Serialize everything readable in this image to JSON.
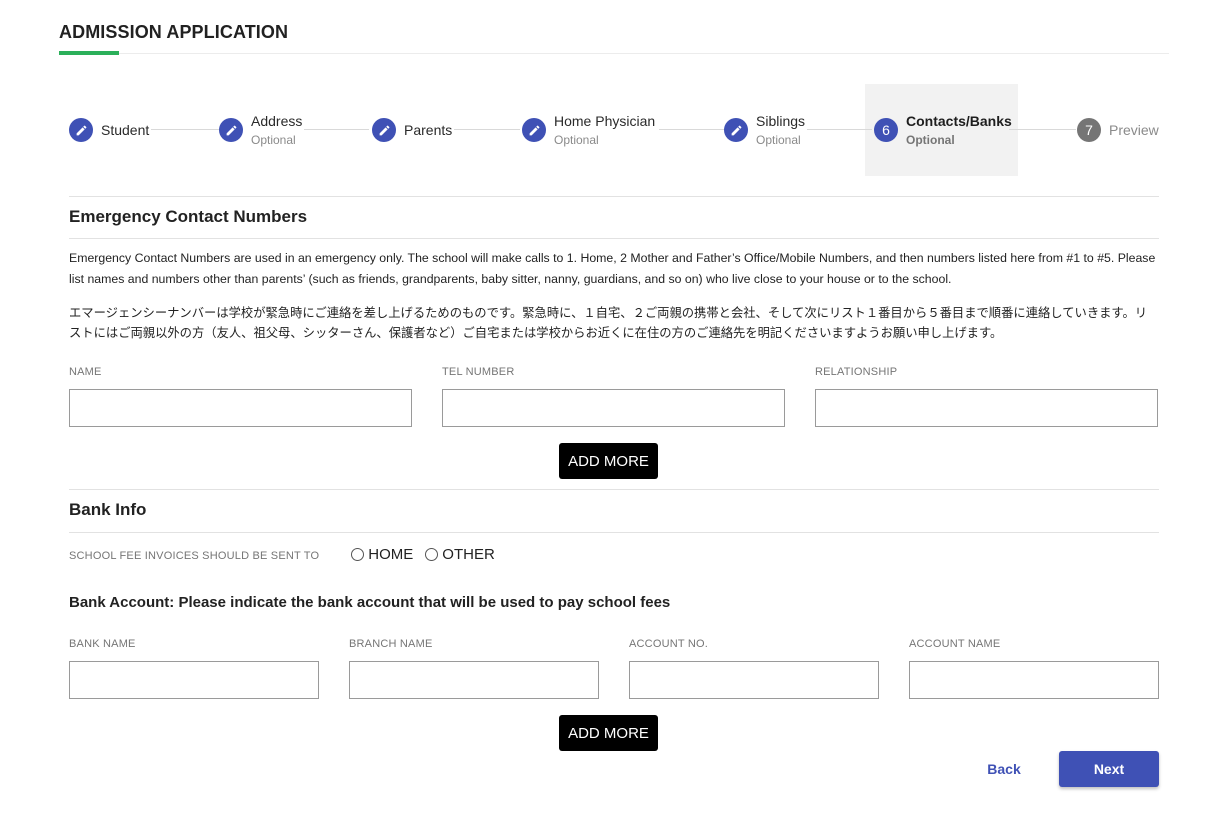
{
  "header": {
    "title": "ADMISSION APPLICATION"
  },
  "stepper": {
    "steps": [
      {
        "number": "",
        "label": "Student",
        "optional": "",
        "state": "completed",
        "icon": "pencil-icon"
      },
      {
        "number": "",
        "label": "Address",
        "optional": "Optional",
        "state": "completed",
        "icon": "pencil-icon"
      },
      {
        "number": "",
        "label": "Parents",
        "optional": "",
        "state": "completed",
        "icon": "pencil-icon"
      },
      {
        "number": "",
        "label": "Home Physician",
        "optional": "Optional",
        "state": "completed",
        "icon": "pencil-icon"
      },
      {
        "number": "",
        "label": "Siblings",
        "optional": "Optional",
        "state": "completed",
        "icon": "pencil-icon"
      },
      {
        "number": "6",
        "label": "Contacts/Banks",
        "optional": "Optional",
        "state": "active"
      },
      {
        "number": "7",
        "label": "Preview",
        "optional": "",
        "state": "pending"
      }
    ]
  },
  "emergency": {
    "title": "Emergency Contact Numbers",
    "description_en": "Emergency Contact Numbers are used in an emergency only. The school will make calls to 1. Home, 2 Mother and Father’s Office/Mobile Numbers, and then numbers listed here from #1 to #5. Please list names and numbers other than parents’ (such as friends, grandparents, baby sitter, nanny, guardians, and so on) who live close to your house or to the school.",
    "description_jp": "エマージェンシーナンバーは学校が緊急時にご連絡を差し上げるためのものです。緊急時に、１自宅、２ご両親の携帯と会社、そして次にリスト１番目から５番目まで順番に連絡していきます。リストにはご両親以外の方（友人、祖父母、シッターさん、保護者など）ご自宅または学校からお近くに在住の方のご連絡先を明記くださいますようお願い申し上げます。",
    "fields": {
      "name_label": "NAME",
      "name_value": "",
      "tel_label": "TEL NUMBER",
      "tel_value": "",
      "relationship_label": "RELATIONSHIP",
      "relationship_value": ""
    },
    "add_more_label": "ADD MORE"
  },
  "bank": {
    "title": "Bank Info",
    "invoice_question": "SCHOOL FEE INVOICES SHOULD BE SENT TO",
    "invoice_options": [
      "HOME",
      "OTHER"
    ],
    "account_heading": "Bank Account: Please indicate the bank account that will be used to pay school fees",
    "fields": {
      "bank_name_label": "BANK NAME",
      "bank_name_value": "",
      "branch_name_label": "BRANCH NAME",
      "branch_name_value": "",
      "account_no_label": "ACCOUNT NO.",
      "account_no_value": "",
      "account_name_label": "ACCOUNT NAME",
      "account_name_value": ""
    },
    "add_more_label": "ADD MORE"
  },
  "footer": {
    "back_label": "Back",
    "next_label": "Next"
  },
  "colors": {
    "accent": "#3f51b5",
    "title_underline": "#2bb05a",
    "active_step_bg": "#f2f2f2",
    "pending_step": "#757575"
  }
}
